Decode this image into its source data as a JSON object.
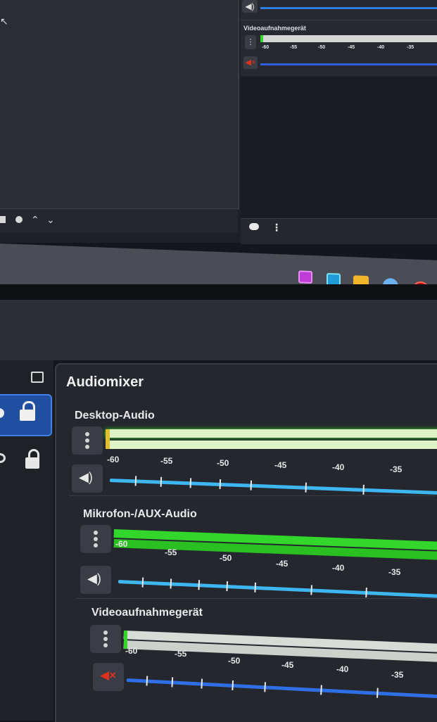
{
  "background_monitor": {
    "mini_mixer": {
      "channel_label": "Videoaufnahmegerät",
      "scale_labels": [
        "-60",
        "-55",
        "-50",
        "-45",
        "-40",
        "-35"
      ]
    },
    "taskbar_icons": [
      "image-viewer-icon",
      "photos-icon",
      "folder-icon",
      "browser-icon",
      "obs-icon"
    ]
  },
  "audiomixer": {
    "title": "Audiomixer",
    "channels": [
      {
        "name": "Desktop-Audio",
        "muted": false,
        "meter_level_db": -60,
        "scale_labels": [
          "-60",
          "-55",
          "-50",
          "-45",
          "-40",
          "-35"
        ],
        "fader_color": "#3db6f2"
      },
      {
        "name": "Mikrofon-/AUX-Audio",
        "muted": false,
        "meter_level_db": -10,
        "scale_labels": [
          "-60",
          "-55",
          "-50",
          "-45",
          "-40",
          "-35"
        ],
        "fader_color": "#3db6f2"
      },
      {
        "name": "Videoaufnahmegerät",
        "muted": true,
        "meter_level_db": -60,
        "scale_labels": [
          "-60",
          "-55",
          "-50",
          "-45",
          "-40",
          "-35"
        ],
        "fader_color": "#2f6fe6"
      }
    ]
  },
  "colors": {
    "accent": "#3f80ea",
    "meter_green": "#33d62a",
    "mute_red": "#e0301e",
    "panel": "#24272d"
  }
}
